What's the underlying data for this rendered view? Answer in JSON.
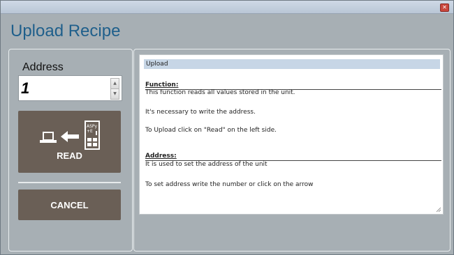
{
  "window": {
    "close_glyph": "✕"
  },
  "header": {
    "title": "Upload Recipe"
  },
  "address": {
    "label": "Address",
    "value": "1",
    "spin_up": "▲",
    "spin_down": "▼"
  },
  "actions": {
    "read_label": "READ",
    "cancel_label": "CANCEL"
  },
  "icons": {
    "read_icon": "computer-arrow-from-device-icon"
  },
  "help": {
    "header": "Upload",
    "function_heading": "Function:",
    "function_lines": [
      "This function reads all values stored in the unit.",
      "It's necessary to write the address.",
      "To Upload click on \"Read\" on the left side."
    ],
    "address_heading": "Address:",
    "address_lines": [
      "It is used to set the address of the unit",
      "To set address write the number or click on the arrow"
    ]
  },
  "colors": {
    "title": "#1f5f8b",
    "button": "#6a5f56",
    "background": "#a7afb4",
    "header_bar": "#c7d6e6"
  }
}
